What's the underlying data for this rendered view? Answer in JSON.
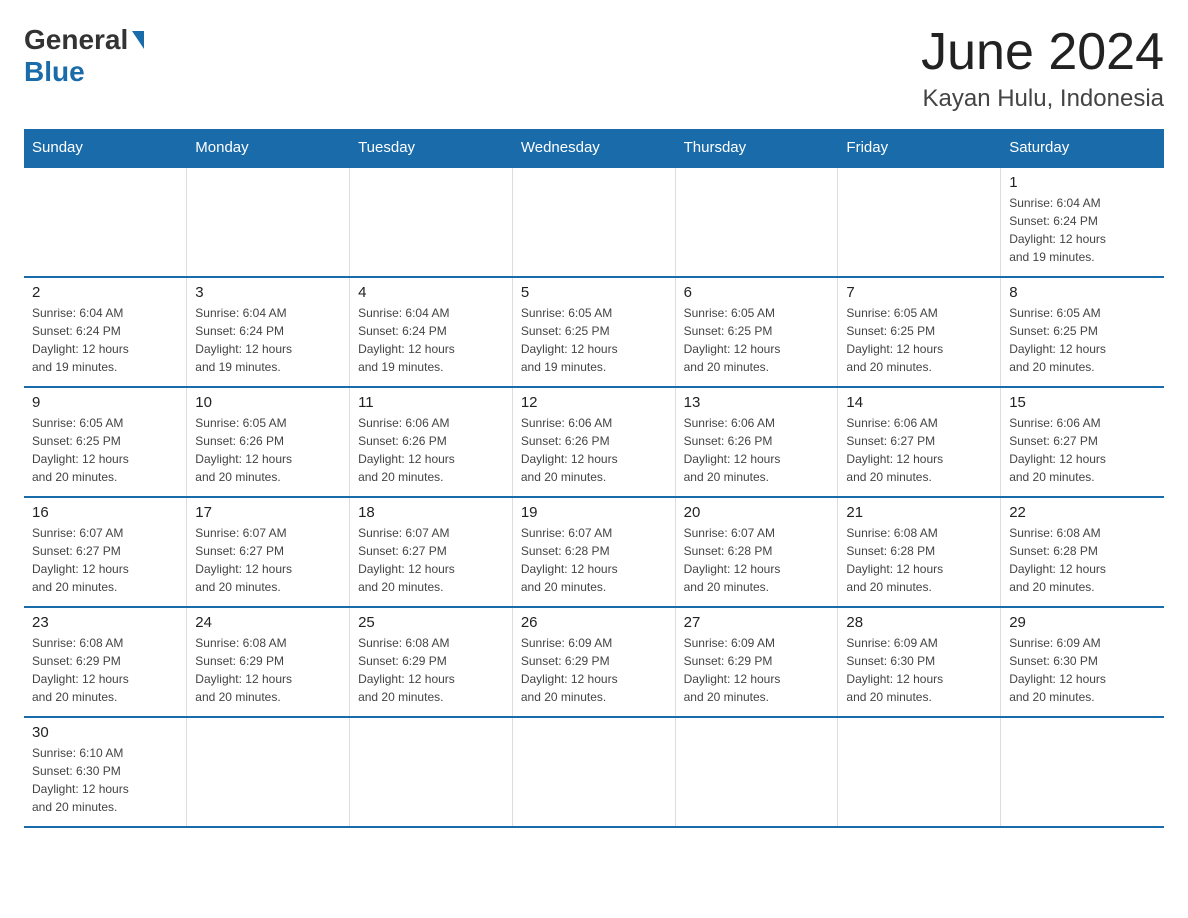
{
  "header": {
    "logo_general": "General",
    "logo_blue": "Blue",
    "title": "June 2024",
    "subtitle": "Kayan Hulu, Indonesia"
  },
  "days_of_week": [
    "Sunday",
    "Monday",
    "Tuesday",
    "Wednesday",
    "Thursday",
    "Friday",
    "Saturday"
  ],
  "weeks": [
    [
      {
        "day": "",
        "info": ""
      },
      {
        "day": "",
        "info": ""
      },
      {
        "day": "",
        "info": ""
      },
      {
        "day": "",
        "info": ""
      },
      {
        "day": "",
        "info": ""
      },
      {
        "day": "",
        "info": ""
      },
      {
        "day": "1",
        "info": "Sunrise: 6:04 AM\nSunset: 6:24 PM\nDaylight: 12 hours\nand 19 minutes."
      }
    ],
    [
      {
        "day": "2",
        "info": "Sunrise: 6:04 AM\nSunset: 6:24 PM\nDaylight: 12 hours\nand 19 minutes."
      },
      {
        "day": "3",
        "info": "Sunrise: 6:04 AM\nSunset: 6:24 PM\nDaylight: 12 hours\nand 19 minutes."
      },
      {
        "day": "4",
        "info": "Sunrise: 6:04 AM\nSunset: 6:24 PM\nDaylight: 12 hours\nand 19 minutes."
      },
      {
        "day": "5",
        "info": "Sunrise: 6:05 AM\nSunset: 6:25 PM\nDaylight: 12 hours\nand 19 minutes."
      },
      {
        "day": "6",
        "info": "Sunrise: 6:05 AM\nSunset: 6:25 PM\nDaylight: 12 hours\nand 20 minutes."
      },
      {
        "day": "7",
        "info": "Sunrise: 6:05 AM\nSunset: 6:25 PM\nDaylight: 12 hours\nand 20 minutes."
      },
      {
        "day": "8",
        "info": "Sunrise: 6:05 AM\nSunset: 6:25 PM\nDaylight: 12 hours\nand 20 minutes."
      }
    ],
    [
      {
        "day": "9",
        "info": "Sunrise: 6:05 AM\nSunset: 6:25 PM\nDaylight: 12 hours\nand 20 minutes."
      },
      {
        "day": "10",
        "info": "Sunrise: 6:05 AM\nSunset: 6:26 PM\nDaylight: 12 hours\nand 20 minutes."
      },
      {
        "day": "11",
        "info": "Sunrise: 6:06 AM\nSunset: 6:26 PM\nDaylight: 12 hours\nand 20 minutes."
      },
      {
        "day": "12",
        "info": "Sunrise: 6:06 AM\nSunset: 6:26 PM\nDaylight: 12 hours\nand 20 minutes."
      },
      {
        "day": "13",
        "info": "Sunrise: 6:06 AM\nSunset: 6:26 PM\nDaylight: 12 hours\nand 20 minutes."
      },
      {
        "day": "14",
        "info": "Sunrise: 6:06 AM\nSunset: 6:27 PM\nDaylight: 12 hours\nand 20 minutes."
      },
      {
        "day": "15",
        "info": "Sunrise: 6:06 AM\nSunset: 6:27 PM\nDaylight: 12 hours\nand 20 minutes."
      }
    ],
    [
      {
        "day": "16",
        "info": "Sunrise: 6:07 AM\nSunset: 6:27 PM\nDaylight: 12 hours\nand 20 minutes."
      },
      {
        "day": "17",
        "info": "Sunrise: 6:07 AM\nSunset: 6:27 PM\nDaylight: 12 hours\nand 20 minutes."
      },
      {
        "day": "18",
        "info": "Sunrise: 6:07 AM\nSunset: 6:27 PM\nDaylight: 12 hours\nand 20 minutes."
      },
      {
        "day": "19",
        "info": "Sunrise: 6:07 AM\nSunset: 6:28 PM\nDaylight: 12 hours\nand 20 minutes."
      },
      {
        "day": "20",
        "info": "Sunrise: 6:07 AM\nSunset: 6:28 PM\nDaylight: 12 hours\nand 20 minutes."
      },
      {
        "day": "21",
        "info": "Sunrise: 6:08 AM\nSunset: 6:28 PM\nDaylight: 12 hours\nand 20 minutes."
      },
      {
        "day": "22",
        "info": "Sunrise: 6:08 AM\nSunset: 6:28 PM\nDaylight: 12 hours\nand 20 minutes."
      }
    ],
    [
      {
        "day": "23",
        "info": "Sunrise: 6:08 AM\nSunset: 6:29 PM\nDaylight: 12 hours\nand 20 minutes."
      },
      {
        "day": "24",
        "info": "Sunrise: 6:08 AM\nSunset: 6:29 PM\nDaylight: 12 hours\nand 20 minutes."
      },
      {
        "day": "25",
        "info": "Sunrise: 6:08 AM\nSunset: 6:29 PM\nDaylight: 12 hours\nand 20 minutes."
      },
      {
        "day": "26",
        "info": "Sunrise: 6:09 AM\nSunset: 6:29 PM\nDaylight: 12 hours\nand 20 minutes."
      },
      {
        "day": "27",
        "info": "Sunrise: 6:09 AM\nSunset: 6:29 PM\nDaylight: 12 hours\nand 20 minutes."
      },
      {
        "day": "28",
        "info": "Sunrise: 6:09 AM\nSunset: 6:30 PM\nDaylight: 12 hours\nand 20 minutes."
      },
      {
        "day": "29",
        "info": "Sunrise: 6:09 AM\nSunset: 6:30 PM\nDaylight: 12 hours\nand 20 minutes."
      }
    ],
    [
      {
        "day": "30",
        "info": "Sunrise: 6:10 AM\nSunset: 6:30 PM\nDaylight: 12 hours\nand 20 minutes."
      },
      {
        "day": "",
        "info": ""
      },
      {
        "day": "",
        "info": ""
      },
      {
        "day": "",
        "info": ""
      },
      {
        "day": "",
        "info": ""
      },
      {
        "day": "",
        "info": ""
      },
      {
        "day": "",
        "info": ""
      }
    ]
  ]
}
